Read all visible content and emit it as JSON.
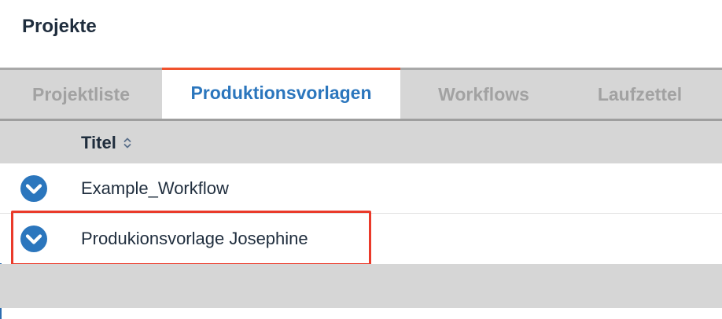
{
  "header": {
    "title": "Projekte"
  },
  "tabs": [
    {
      "label": "Projektliste",
      "active": false
    },
    {
      "label": "Produktionsvorlagen",
      "active": true
    },
    {
      "label": "Workflows",
      "active": false
    },
    {
      "label": "Laufzettel",
      "active": false
    }
  ],
  "table": {
    "columns": [
      {
        "label": "Titel",
        "sort_icon": "sort-icon"
      }
    ],
    "rows": [
      {
        "title": "Example_Workflow",
        "icon": "chevron-down-circle-icon",
        "highlighted": false
      },
      {
        "title": "Produkionsvorlage Josephine",
        "icon": "chevron-down-circle-icon",
        "highlighted": true
      }
    ]
  },
  "colors": {
    "accent_blue": "#2b76bd",
    "active_tab_border": "#f0522d",
    "highlight_border": "#ea3a2a",
    "tab_background": "#d6d6d6",
    "inactive_tab_text": "#a2a2a2",
    "dark_text": "#1f2d3d"
  }
}
